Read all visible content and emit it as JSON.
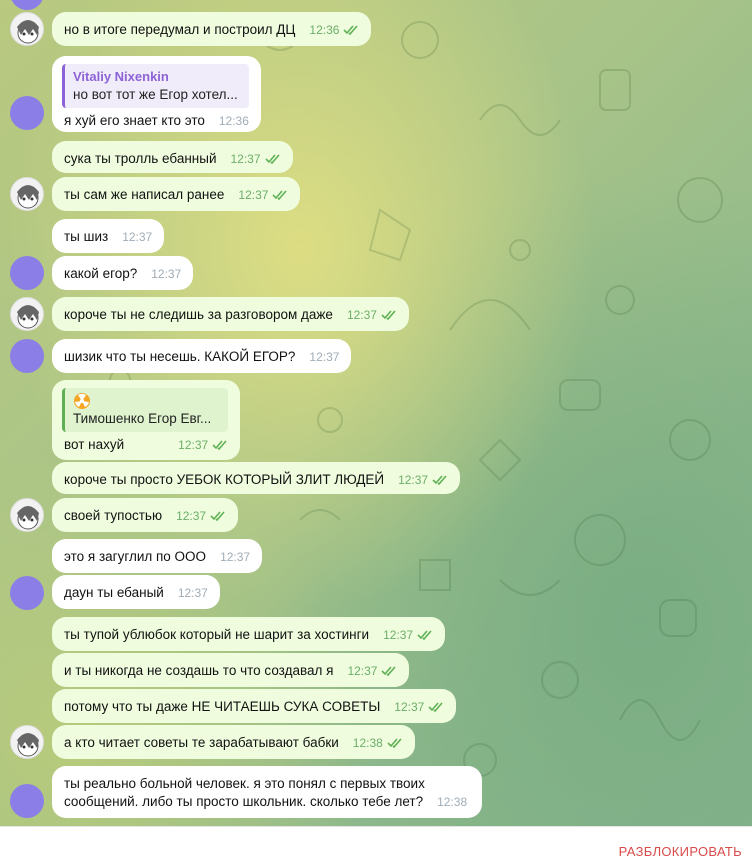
{
  "messages": [
    {
      "text": "но в итоге передумал и построил ДЦ",
      "time": "12:36"
    },
    {
      "reply_name": "Vitaliy Nixenkin",
      "reply_text": "но вот тот же Егор хотел...",
      "text": "я хуй его знает кто это",
      "time": "12:36"
    },
    {
      "text": "сука ты тролль ебанный",
      "time": "12:37"
    },
    {
      "text": "ты сам же написал ранее",
      "time": "12:37"
    },
    {
      "text": "ты шиз",
      "time": "12:37"
    },
    {
      "text": "какой егор?",
      "time": "12:37"
    },
    {
      "text": "короче ты не следишь за разговором даже",
      "time": "12:37"
    },
    {
      "text": "шизик что ты несешь. КАКОЙ ЕГОР?",
      "time": "12:37"
    },
    {
      "reply_text": "Тимошенко Егор Евг...",
      "text": "вот нахуй",
      "time": "12:37"
    },
    {
      "text": "короче ты просто УЕБОК КОТОРЫЙ ЗЛИТ ЛЮДЕЙ",
      "time": "12:37"
    },
    {
      "text": "своей тупостью",
      "time": "12:37"
    },
    {
      "text": "это я загуглил по ООО",
      "time": "12:37"
    },
    {
      "text": "даун ты ебаный",
      "time": "12:37"
    },
    {
      "text": "ты тупой ублюбок который не шарит за хостинги",
      "time": "12:37"
    },
    {
      "text": "и ты никогда не создашь то что создавал я",
      "time": "12:37"
    },
    {
      "text": "потому что ты даже НЕ ЧИТАЕШЬ СУКА СОВЕТЫ",
      "time": "12:37"
    },
    {
      "text": "а кто читает советы те зарабатывают бабки",
      "time": "12:38"
    },
    {
      "text_line1": "ты реально больной человек. я это понял с первых твоих",
      "text_line2": "сообщений. либо ты просто школьник. сколько тебе лет?",
      "time": "12:38"
    }
  ],
  "bottom": {
    "unblock_label": "РАЗБЛОКИРОВАТЬ"
  },
  "colors": {
    "outgoing_bubble": "#effdde",
    "incoming_bubble": "#ffffff",
    "reply_accent": "#8c63d6",
    "read_ticks": "#5fb055",
    "unblock": "#d74b4b",
    "purple_avatar": "#8b7ee6"
  }
}
